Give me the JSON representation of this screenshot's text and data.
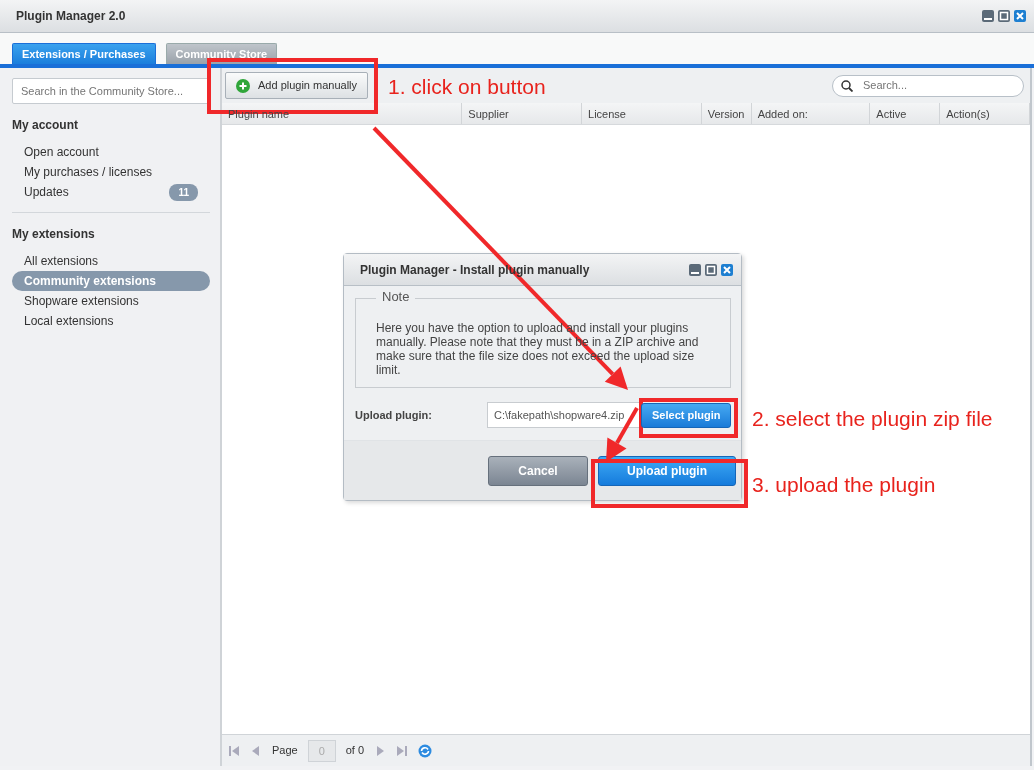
{
  "window": {
    "title": "Plugin Manager 2.0"
  },
  "tabs": [
    {
      "label": "Extensions / Purchases",
      "selected": true
    },
    {
      "label": "Community Store",
      "selected": false
    }
  ],
  "sidebar": {
    "search": {
      "placeholder": "Search in the Community Store..."
    },
    "sections": [
      {
        "title": "My account",
        "items": [
          {
            "label": "Open account",
            "selected": false
          },
          {
            "label": "My purchases / licenses",
            "selected": false
          },
          {
            "label": "Updates",
            "badge": "11",
            "selected": false
          }
        ]
      },
      {
        "title": "My extensions",
        "items": [
          {
            "label": "All extensions",
            "selected": false
          },
          {
            "label": "Community extensions",
            "selected": true
          },
          {
            "label": "Shopware extensions",
            "selected": false
          },
          {
            "label": "Local extensions",
            "selected": false
          }
        ]
      }
    ]
  },
  "toolbar": {
    "add_button": "Add plugin manually",
    "search": {
      "placeholder": "Search..."
    }
  },
  "table": {
    "columns": [
      "Plugin name",
      "Supplier",
      "License",
      "Version",
      "Added on:",
      "Active",
      "Action(s)"
    ]
  },
  "paging": {
    "page_label": "Page",
    "page_value": "0",
    "of_label": "of 0"
  },
  "dialog": {
    "title": "Plugin Manager - Install plugin manually",
    "note": {
      "legend": "Note",
      "text": "Here you have the option to upload and install your plugins manually. Please note that they must be in a ZIP archive and make sure that the file size does not exceed the upload size limit."
    },
    "upload_label": "Upload plugin:",
    "file_value": "C:\\fakepath\\shopware4.zip",
    "select_button": "Select plugin",
    "buttons": [
      {
        "label": "Cancel",
        "kind": "secondary"
      },
      {
        "label": "Upload plugin",
        "kind": "primary"
      }
    ]
  },
  "annotations": [
    {
      "text": "1. click on button"
    },
    {
      "text": "2. select the plugin zip file"
    },
    {
      "text": "3. upload the plugin"
    }
  ]
}
